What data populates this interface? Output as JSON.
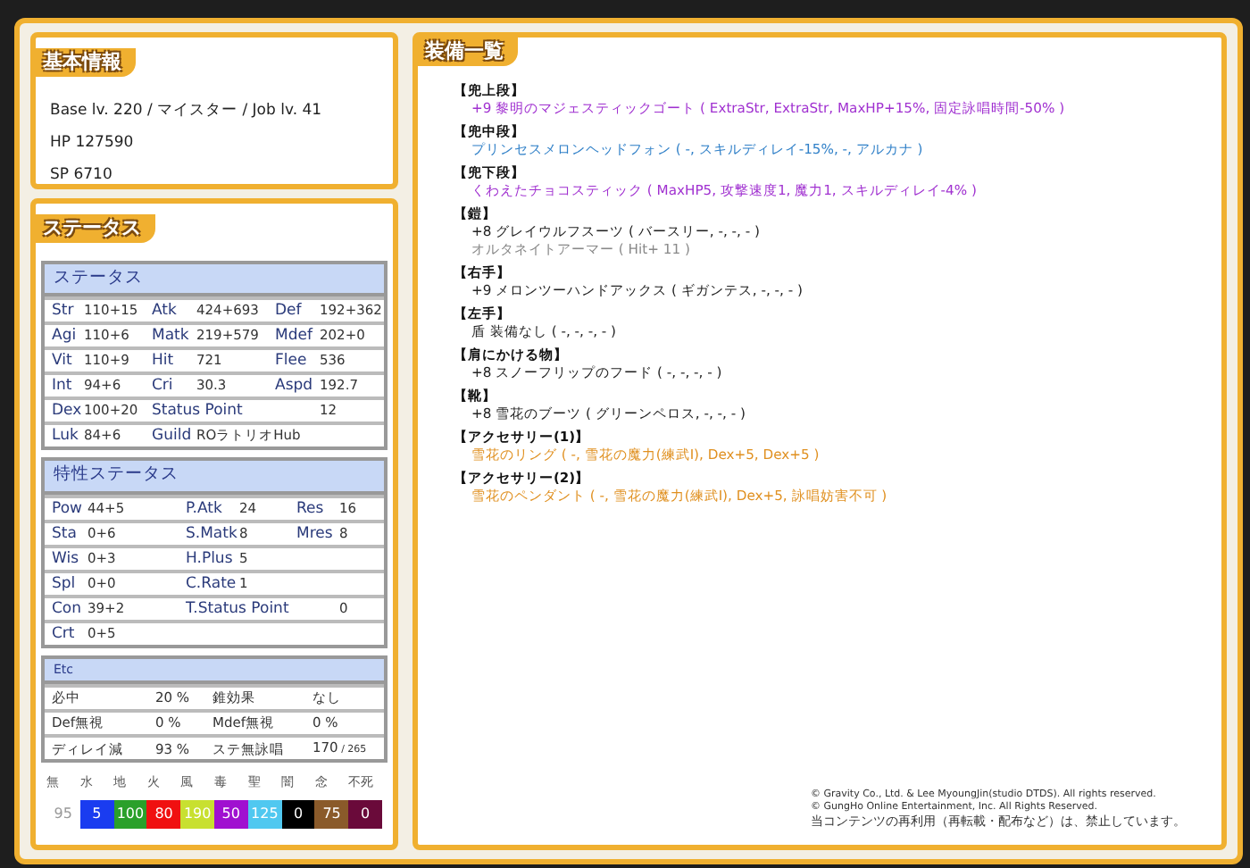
{
  "basic_info": {
    "title": "基本情報",
    "lines": [
      "Base lv. 220 / マイスター / Job lv. 41",
      "HP 127590",
      "SP 6710"
    ]
  },
  "status": {
    "title": "ステータス",
    "tables": [
      {
        "kind": "stats",
        "title": "ステータス",
        "rows": [
          [
            {
              "label": "Str",
              "value": "110+15"
            },
            {
              "label": "Atk",
              "value": "424+693"
            },
            {
              "label": "Def",
              "value": "192+362"
            }
          ],
          [
            {
              "label": "Agi",
              "value": "110+6"
            },
            {
              "label": "Matk",
              "value": "219+579"
            },
            {
              "label": "Mdef",
              "value": "202+0"
            }
          ],
          [
            {
              "label": "Vit",
              "value": "110+9"
            },
            {
              "label": "Hit",
              "value": "721"
            },
            {
              "label": "Flee",
              "value": "536"
            }
          ],
          [
            {
              "label": "Int",
              "value": "94+6"
            },
            {
              "label": "Cri",
              "value": "30.3"
            },
            {
              "label": "Aspd",
              "value": "192.7"
            }
          ],
          [
            {
              "label": "Dex",
              "value": "100+20"
            },
            {
              "label": "Status Point",
              "value": "12",
              "kind": "wide"
            }
          ],
          [
            {
              "label": "Luk",
              "value": "84+6"
            },
            {
              "label": "Guild",
              "value": "ROラトリオHub",
              "kind": "long"
            }
          ]
        ]
      },
      {
        "kind": "traits",
        "title": "特性ステータス",
        "rows": [
          [
            {
              "label": "Pow",
              "value": "44+5"
            },
            {
              "label": "P.Atk",
              "value": "24"
            },
            {
              "label": "Res",
              "value": "16"
            }
          ],
          [
            {
              "label": "Sta",
              "value": "0+6"
            },
            {
              "label": "S.Matk",
              "value": "8"
            },
            {
              "label": "Mres",
              "value": "8"
            }
          ],
          [
            {
              "label": "Wis",
              "value": "0+3"
            },
            {
              "label": "H.Plus",
              "value": "5"
            }
          ],
          [
            {
              "label": "Spl",
              "value": "0+0"
            },
            {
              "label": "C.Rate",
              "value": "1"
            }
          ],
          [
            {
              "label": "Con",
              "value": "39+2"
            },
            {
              "label": "T.Status Point",
              "value": "0",
              "kind": "wide"
            }
          ],
          [
            {
              "label": "Crt",
              "value": "0+5"
            }
          ]
        ]
      },
      {
        "kind": "etc",
        "title": "Etc",
        "rows": [
          [
            {
              "label": "必中",
              "value": "20 %"
            },
            {
              "label": "錐効果",
              "value": "なし"
            }
          ],
          [
            {
              "label": "Def無視",
              "value": "0 %"
            },
            {
              "label": "Mdef無視",
              "value": "0 %"
            }
          ],
          [
            {
              "label": "ディレイ減",
              "value": "93 %"
            },
            {
              "label": "ステ無詠唱",
              "value": "170",
              "max": "/ 265"
            }
          ]
        ]
      }
    ],
    "elements": [
      {
        "label": "無",
        "value": "95",
        "color": "#ffffff"
      },
      {
        "label": "水",
        "value": "5",
        "color": "#1a3cf0"
      },
      {
        "label": "地",
        "value": "100",
        "color": "#2aa02a"
      },
      {
        "label": "火",
        "value": "80",
        "color": "#f01010"
      },
      {
        "label": "風",
        "value": "190",
        "color": "#c8e030"
      },
      {
        "label": "毒",
        "value": "50",
        "color": "#a010d0"
      },
      {
        "label": "聖",
        "value": "125",
        "color": "#50c8f0"
      },
      {
        "label": "闇",
        "value": "0",
        "color": "#000000"
      },
      {
        "label": "念",
        "value": "75",
        "color": "#8a5a2a"
      },
      {
        "label": "不死",
        "value": "0",
        "color": "#6a0a3a"
      }
    ]
  },
  "equipment": {
    "title": "装備一覧",
    "slots": [
      {
        "slot": "【兜上段】",
        "items": [
          {
            "text": "+9 黎明のマジェスティックゴート ( ExtraStr, ExtraStr, MaxHP+15%, 固定詠唱時間-50% )",
            "color": "#a030d0"
          }
        ]
      },
      {
        "slot": "【兜中段】",
        "items": [
          {
            "text": "プリンセスメロンヘッドフォン ( -, スキルディレイ-15%, -, アルカナ )",
            "color": "#3080c8"
          }
        ]
      },
      {
        "slot": "【兜下段】",
        "items": [
          {
            "text": "くわえたチョコスティック ( MaxHP5, 攻撃速度1, 魔力1, スキルディレイ-4% )",
            "color": "#a030d0"
          }
        ]
      },
      {
        "slot": "【鎧】",
        "items": [
          {
            "text": "+8 グレイウルフスーツ ( バースリー, -, -, - )",
            "color": "#222222"
          },
          {
            "text": "オルタネイトアーマー ( Hit+ 11 )",
            "color": "#888888"
          }
        ]
      },
      {
        "slot": "【右手】",
        "items": [
          {
            "text": "+9 メロンツーハンドアックス ( ギガンテス, -, -, - )",
            "color": "#222222"
          }
        ]
      },
      {
        "slot": "【左手】",
        "items": [
          {
            "text": "盾 装備なし ( -, -, -, - )",
            "color": "#222222"
          }
        ]
      },
      {
        "slot": "【肩にかける物】",
        "items": [
          {
            "text": "+8 スノーフリップのフード ( -, -, -, - )",
            "color": "#222222"
          }
        ]
      },
      {
        "slot": "【靴】",
        "items": [
          {
            "text": "+8 雪花のブーツ ( グリーンペロス, -, -, - )",
            "color": "#222222"
          }
        ]
      },
      {
        "slot": "【アクセサリー(1)】",
        "items": [
          {
            "text": "雪花のリング ( -, 雪花の魔力(練武I), Dex+5, Dex+5 )",
            "color": "#e09020"
          }
        ]
      },
      {
        "slot": "【アクセサリー(2)】",
        "items": [
          {
            "text": "雪花のペンダント ( -, 雪花の魔力(練武I), Dex+5, 詠唱妨害不可 )",
            "color": "#e09020"
          }
        ]
      }
    ],
    "copyright": [
      "© Gravity Co., Ltd. & Lee MyoungJin(studio DTDS). All rights reserved.",
      "© GungHo Online Entertainment, Inc. All Rights Reserved.",
      "当コンテンツの再利用（再転載・配布など）は、禁止しています。"
    ]
  }
}
